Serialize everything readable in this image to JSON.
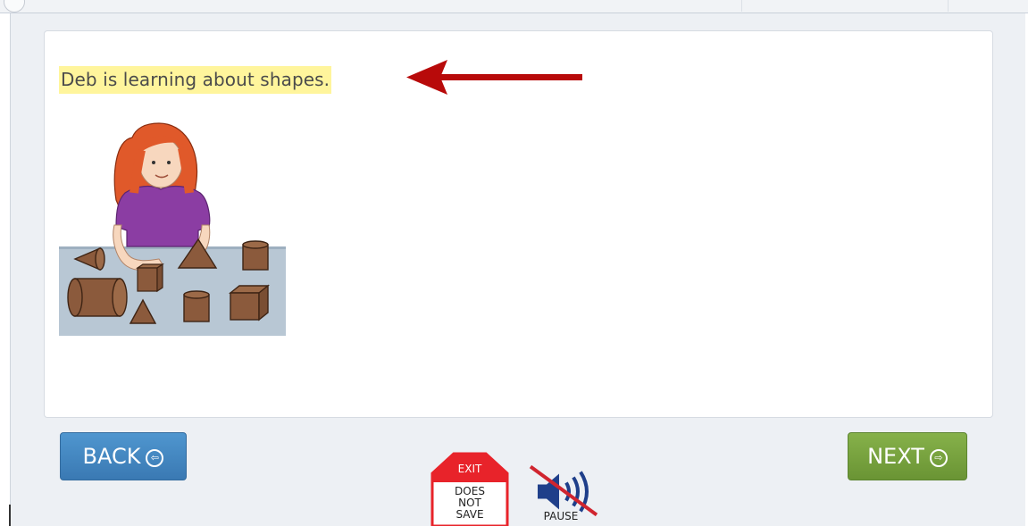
{
  "lesson": {
    "sentence": "Deb is learning about shapes."
  },
  "navigation": {
    "back_label": "BACK",
    "next_label": "NEXT"
  },
  "controls": {
    "exit_label": "EXIT",
    "exit_note_line1": "DOES",
    "exit_note_line2": "NOT",
    "exit_note_line3": "SAVE",
    "pause_label": "PAUSE"
  },
  "icons": {
    "back": "arrow-left-circle-icon",
    "next": "arrow-right-circle-icon",
    "exit": "stop-sign-icon",
    "audio": "speaker-muted-icon",
    "pointer": "red-arrow-left-icon"
  },
  "colors": {
    "highlight": "#fff59c",
    "back_button": "#3f83bf",
    "next_button": "#76a23c",
    "exit_red": "#e8232a",
    "arrow_red": "#b80a0a"
  }
}
